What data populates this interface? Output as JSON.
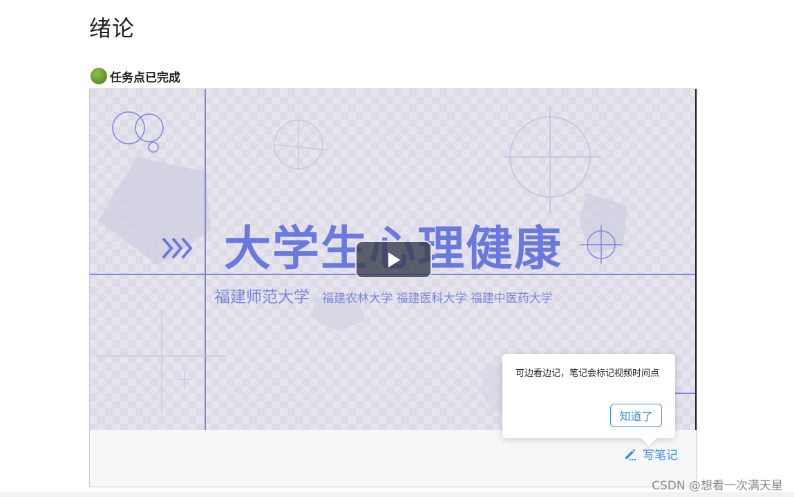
{
  "page": {
    "title": "绪论"
  },
  "task": {
    "status_label": "任务点已完成",
    "status_color": "#6b9b34"
  },
  "video": {
    "slide_title": "大学生心理健康",
    "slide_main_university": "福建师范大学",
    "slide_universities": "福建农林大学 福建医科大学 福建中医药大学",
    "play_icon": "play-icon"
  },
  "tooltip": {
    "text": "可边看边记，笔记会标记视频时间点",
    "confirm_label": "知道了"
  },
  "note": {
    "label": "写笔记",
    "icon": "pencil-icon",
    "accent_color": "#3a8ee6"
  },
  "watermark": {
    "text": "CSDN @想看一次满天星"
  }
}
